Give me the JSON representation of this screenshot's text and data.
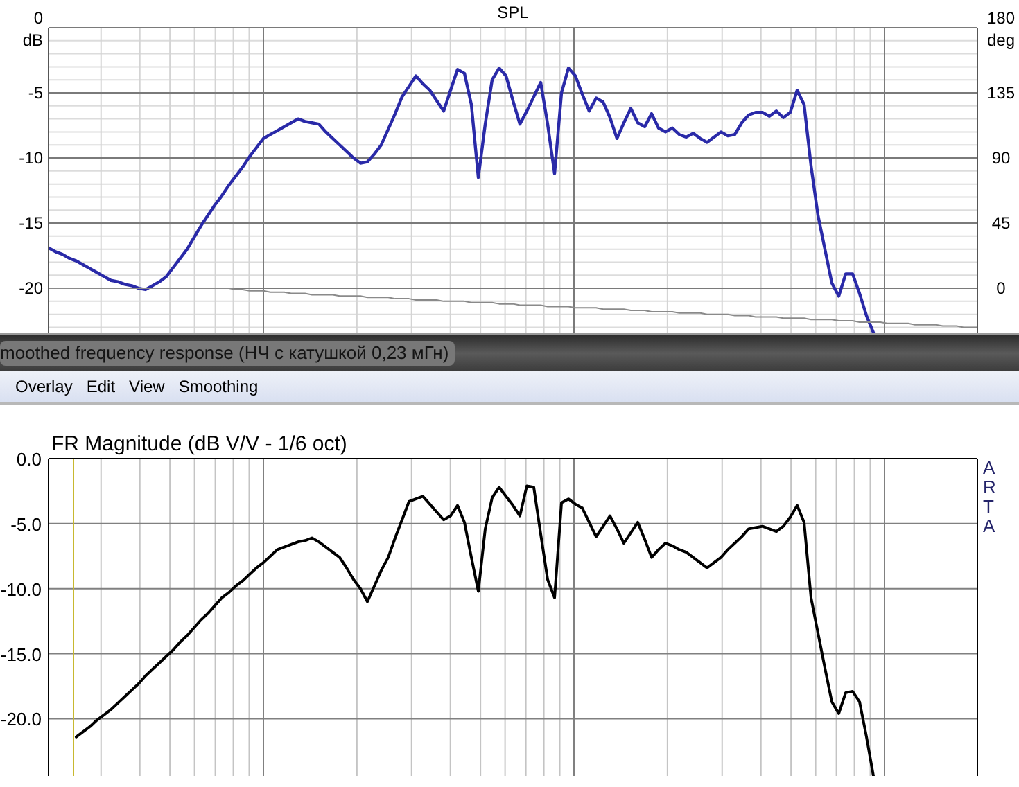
{
  "top_chart": {
    "right_unit": "deg",
    "right_ticks": [
      "180",
      "135",
      "90",
      "45",
      "0"
    ],
    "chart_data": {
      "type": "line",
      "title": "SPL",
      "ylabel": "dB",
      "ylim": [
        -23.4,
        0
      ],
      "grid": true,
      "yticks": [
        {
          "value": 0,
          "label": "0"
        },
        {
          "value": -5,
          "label": "-5"
        },
        {
          "value": -10,
          "label": "-10"
        },
        {
          "value": -15,
          "label": "-15"
        },
        {
          "value": -20,
          "label": "-20"
        }
      ],
      "categories": [
        null,
        null,
        null,
        null,
        null,
        null,
        null,
        null,
        null,
        null,
        null,
        null,
        null,
        null,
        null,
        null,
        null,
        null,
        null,
        null,
        null,
        null,
        null,
        null,
        null,
        null,
        null,
        null,
        null,
        null,
        null,
        null,
        null,
        null,
        null,
        null,
        null,
        null,
        null,
        null,
        null,
        null,
        null,
        null,
        null,
        null,
        null,
        null,
        null,
        null,
        null,
        null,
        null,
        null,
        null,
        null,
        null,
        null,
        null,
        null,
        null,
        null,
        null,
        null,
        null,
        null,
        null,
        null,
        null,
        null,
        null,
        null,
        null,
        null,
        null,
        null,
        null,
        null,
        null,
        null,
        null,
        null,
        null,
        null,
        null,
        null,
        null,
        null,
        null,
        null,
        null,
        null,
        null,
        null,
        null,
        null,
        null,
        null,
        null,
        null,
        null,
        null,
        null,
        null,
        null,
        null,
        null,
        null,
        null,
        null,
        null,
        null,
        null,
        null,
        null,
        null,
        null,
        null,
        null,
        null,
        null,
        null,
        null,
        null,
        null,
        null,
        null,
        null,
        null,
        null,
        null,
        null,
        null,
        null,
        null
      ],
      "series": [
        {
          "color": "#2a2aa8",
          "values": [
            -16.9,
            -17.2,
            -17.4,
            -17.7,
            -17.9,
            -18.2,
            -18.5,
            -18.8,
            -19.1,
            -19.4,
            -19.5,
            -19.7,
            -19.8,
            -20.0,
            -20.1,
            -19.8,
            -19.5,
            -19.1,
            -18.4,
            -17.7,
            -17.0,
            -16.1,
            -15.2,
            -14.4,
            -13.6,
            -12.9,
            -12.1,
            -11.4,
            -10.7,
            -9.9,
            -9.2,
            -8.5,
            -8.2,
            -7.9,
            -7.6,
            -7.3,
            -7.0,
            -7.2,
            -7.3,
            -7.4,
            -8.0,
            -8.5,
            -9.0,
            -9.5,
            -10.0,
            -10.4,
            -10.3,
            -9.7,
            -9.0,
            -7.8,
            -6.6,
            -5.3,
            -4.5,
            -3.7,
            -4.3,
            -4.8,
            -5.6,
            -6.4,
            -4.8,
            -3.2,
            -3.5,
            -5.9,
            -11.5,
            -7.4,
            -4.0,
            -3.1,
            -3.7,
            -5.6,
            -7.4,
            -6.4,
            -5.3,
            -4.2,
            -7.4,
            -11.2,
            -5.0,
            -3.1,
            -3.7,
            -5.1,
            -6.4,
            -5.4,
            -5.7,
            -6.9,
            -8.5,
            -7.3,
            -6.2,
            -7.3,
            -7.6,
            -6.6,
            -7.7,
            -8.0,
            -7.7,
            -8.2,
            -8.4,
            -8.1,
            -8.5,
            -8.8,
            -8.4,
            -8.0,
            -8.3,
            -8.2,
            -7.3,
            -6.7,
            -6.5,
            -6.5,
            -6.8,
            -6.4,
            -6.9,
            -6.5,
            -4.8,
            -5.9,
            -10.6,
            -14.4,
            -17.0,
            -19.6,
            -20.6,
            -18.9,
            -18.9,
            -20.4,
            -22.1,
            -23.4,
            null,
            null,
            null,
            null,
            null,
            null,
            null,
            null,
            null,
            null,
            null,
            null,
            null,
            null,
            null
          ]
        },
        {
          "color": "#8a8a8a",
          "values": [
            -20.0,
            -20.0,
            -20.0,
            -20.0,
            -20.0,
            -20.0,
            -20.0,
            -20.0,
            -20.0,
            -20.0,
            -20.0,
            -20.0,
            -20.0,
            -20.0,
            -20.0,
            -20.0,
            -20.0,
            -20.0,
            -20.0,
            -20.0,
            -20.0,
            -20.0,
            -20.0,
            -20.0,
            -20.0,
            -20.0,
            -20.0,
            -20.1,
            -20.1,
            -20.2,
            -20.2,
            -20.2,
            -20.3,
            -20.3,
            -20.3,
            -20.4,
            -20.4,
            -20.4,
            -20.5,
            -20.5,
            -20.5,
            -20.5,
            -20.6,
            -20.6,
            -20.6,
            -20.6,
            -20.7,
            -20.7,
            -20.7,
            -20.7,
            -20.8,
            -20.8,
            -20.8,
            -20.9,
            -20.9,
            -20.9,
            -20.9,
            -21.0,
            -21.0,
            -21.0,
            -21.0,
            -21.1,
            -21.1,
            -21.1,
            -21.1,
            -21.2,
            -21.2,
            -21.2,
            -21.3,
            -21.3,
            -21.3,
            -21.3,
            -21.4,
            -21.4,
            -21.4,
            -21.4,
            -21.5,
            -21.5,
            -21.5,
            -21.5,
            -21.6,
            -21.6,
            -21.6,
            -21.6,
            -21.7,
            -21.7,
            -21.7,
            -21.8,
            -21.8,
            -21.8,
            -21.8,
            -21.9,
            -21.9,
            -21.9,
            -21.9,
            -22.0,
            -22.0,
            -22.0,
            -22.0,
            -22.1,
            -22.1,
            -22.1,
            -22.2,
            -22.2,
            -22.2,
            -22.2,
            -22.3,
            -22.3,
            -22.3,
            -22.3,
            -22.4,
            -22.4,
            -22.4,
            -22.4,
            -22.5,
            -22.5,
            -22.5,
            -22.6,
            -22.6,
            -22.6,
            -22.6,
            -22.7,
            -22.7,
            -22.7,
            -22.7,
            -22.8,
            -22.8,
            -22.8,
            -22.8,
            -22.9,
            -22.9,
            -22.9,
            -23.0,
            -23.0,
            -23.0
          ]
        }
      ]
    }
  },
  "window": {
    "title": "moothed frequency response (НЧ с катушкой 0,23 мГн)"
  },
  "menu": [
    "Overlay",
    "Edit",
    "View",
    "Smoothing"
  ],
  "bottom_chart": {
    "watermark_letters": "ARTA",
    "chart_data": {
      "type": "line",
      "title": "FR Magnitude (dB V/V - 1/6 oct)",
      "ylim": [
        -24.4,
        0
      ],
      "grid": true,
      "yticks": [
        {
          "value": 0,
          "label": "0.0"
        },
        {
          "value": -5,
          "label": "-5.0"
        },
        {
          "value": -10,
          "label": "-10.0"
        },
        {
          "value": -15,
          "label": "-15.0"
        },
        {
          "value": -20,
          "label": "-20.0"
        }
      ],
      "categories": [
        null,
        null,
        null,
        null,
        null,
        null,
        null,
        null,
        null,
        null,
        null,
        null,
        null,
        null,
        null,
        null,
        null,
        null,
        null,
        null,
        null,
        null,
        null,
        null,
        null,
        null,
        null,
        null,
        null,
        null,
        null,
        null,
        null,
        null,
        null,
        null,
        null,
        null,
        null,
        null,
        null,
        null,
        null,
        null,
        null,
        null,
        null,
        null,
        null,
        null,
        null,
        null,
        null,
        null,
        null,
        null,
        null,
        null,
        null,
        null,
        null,
        null,
        null,
        null,
        null,
        null,
        null,
        null,
        null,
        null,
        null,
        null,
        null,
        null,
        null,
        null,
        null,
        null,
        null,
        null,
        null,
        null,
        null,
        null,
        null,
        null,
        null,
        null,
        null,
        null,
        null,
        null,
        null,
        null,
        null,
        null,
        null,
        null,
        null,
        null,
        null,
        null,
        null,
        null,
        null,
        null,
        null,
        null,
        null,
        null,
        null,
        null,
        null,
        null,
        null,
        null,
        null,
        null,
        null,
        null,
        null,
        null,
        null,
        null,
        null,
        null,
        null,
        null,
        null,
        null,
        null,
        null,
        null,
        null,
        null
      ],
      "series": [
        {
          "color": "#000000",
          "values": [
            null,
            null,
            null,
            null,
            -21.4,
            -21.0,
            -20.6,
            -20.1,
            -19.7,
            -19.3,
            -18.8,
            -18.3,
            -17.8,
            -17.3,
            -16.7,
            -16.2,
            -15.7,
            -15.2,
            -14.7,
            -14.1,
            -13.6,
            -13.0,
            -12.4,
            -11.9,
            -11.3,
            -10.7,
            -10.3,
            -9.8,
            -9.4,
            -8.9,
            -8.4,
            -8.0,
            -7.5,
            -7.0,
            -6.8,
            -6.6,
            -6.4,
            -6.3,
            -6.1,
            -6.4,
            -6.8,
            -7.2,
            -7.6,
            -8.4,
            -9.3,
            -10.0,
            -11.0,
            -9.8,
            -8.6,
            -7.6,
            -6.1,
            -4.7,
            -3.3,
            -3.1,
            -2.9,
            -3.5,
            -4.1,
            -4.7,
            -4.4,
            -3.6,
            -4.9,
            -7.6,
            -10.2,
            -5.4,
            -3.0,
            -2.2,
            -2.9,
            -3.6,
            -4.4,
            -2.1,
            -2.2,
            -5.8,
            -9.3,
            -10.7,
            -3.4,
            -3.1,
            -3.5,
            -3.8,
            -4.9,
            -6.0,
            -5.2,
            -4.4,
            -5.4,
            -6.5,
            -5.7,
            -4.9,
            -6.2,
            -7.6,
            -7.0,
            -6.5,
            -6.7,
            -7.0,
            -7.2,
            -7.6,
            -8.0,
            -8.4,
            -8.0,
            -7.6,
            -7.0,
            -6.5,
            -6.0,
            -5.4,
            -5.3,
            -5.2,
            -5.4,
            -5.6,
            -5.2,
            -4.5,
            -3.6,
            -4.9,
            -10.7,
            -13.4,
            -16.1,
            -18.7,
            -19.6,
            -18.0,
            -17.9,
            -18.7,
            -21.4,
            -24.4,
            null,
            null,
            null,
            null,
            null,
            null,
            null,
            null,
            null,
            null,
            null,
            null,
            null,
            null,
            null
          ]
        }
      ]
    }
  }
}
